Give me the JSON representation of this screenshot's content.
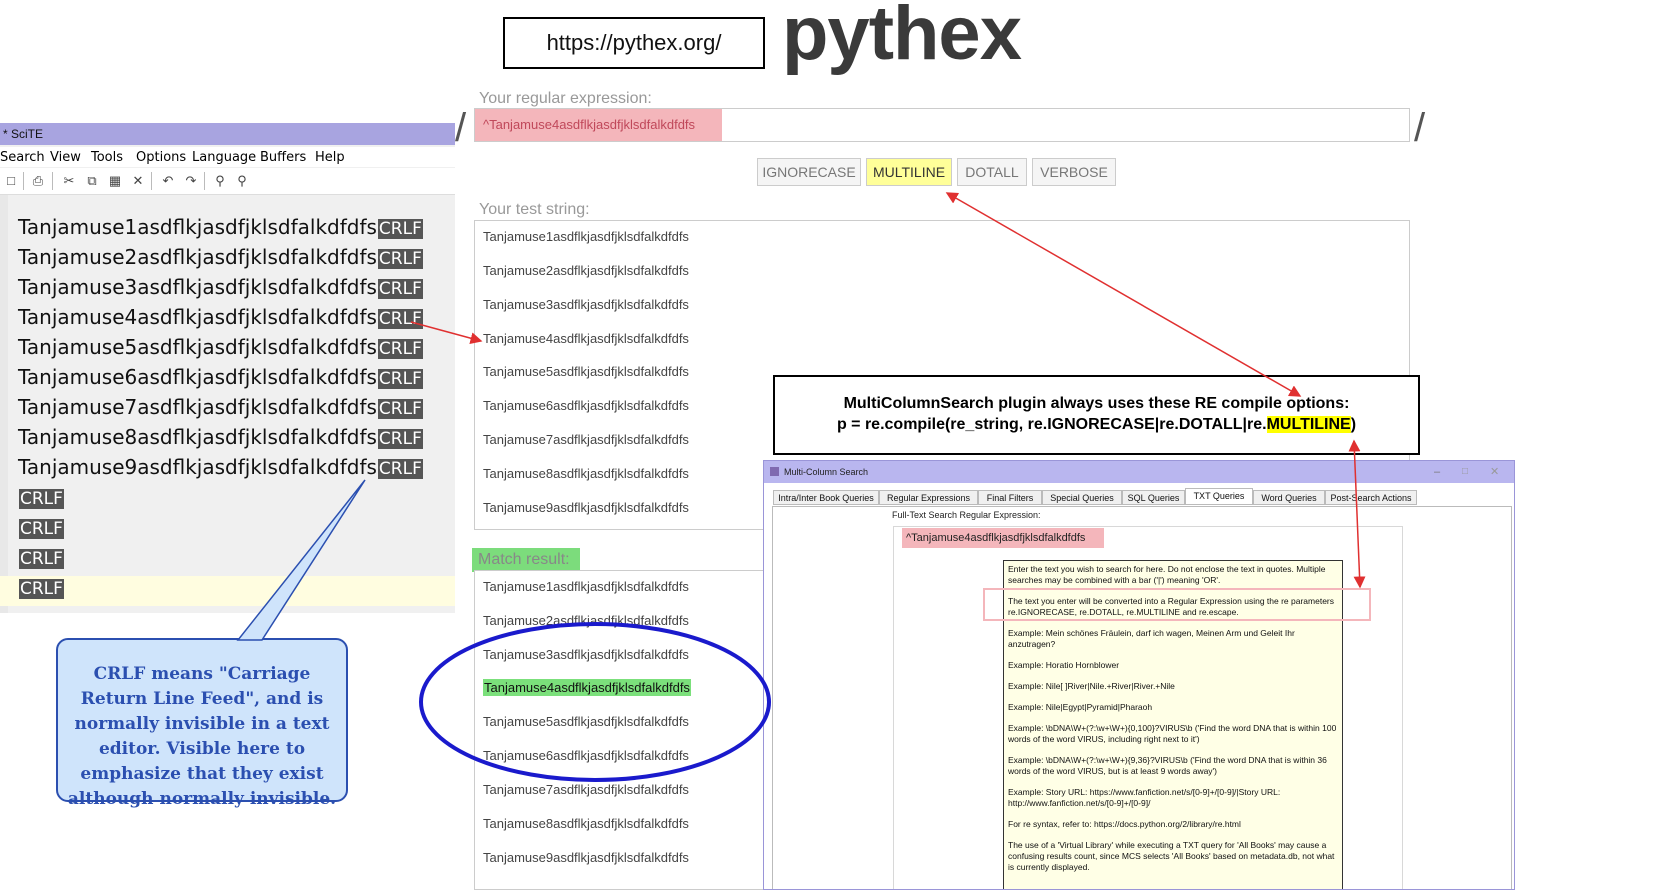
{
  "url_label": "https://pythex.org/",
  "logo": "pythex",
  "scite": {
    "title": "* SciTE",
    "menu": [
      "Search",
      "View",
      "Tools",
      "Options",
      "Language",
      "Buffers",
      "Help"
    ],
    "lines": [
      "Tanjamuse1asdflkjasdfjklsdfalkdfdfs",
      "Tanjamuse2asdflkjasdfjklsdfalkdfdfs",
      "Tanjamuse3asdflkjasdfjklsdfalkdfdfs",
      "Tanjamuse4asdflkjasdfjklsdfalkdfdfs",
      "Tanjamuse5asdflkjasdfjklsdfalkdfdfs",
      "Tanjamuse6asdflkjasdfjklsdfalkdfdfs",
      "Tanjamuse7asdflkjasdfjklsdfalkdfdfs",
      "Tanjamuse8asdflkjasdfjklsdfalkdfdfs",
      "Tanjamuse9asdflkjasdfjklsdfalkdfdfs",
      "",
      "",
      "",
      ""
    ],
    "eol_marker": "CRLF"
  },
  "callout": {
    "text": "CRLF means \"Carriage Return Line Feed\", and is normally invisible in a text editor.  Visible here to emphasize that they exist although normally invisible."
  },
  "pythex": {
    "regex_label": "Your regular expression:",
    "regex_value": "^Tanjamuse4asdflkjasdfjklsdfalkdfdfs",
    "slash": "/",
    "flags": [
      "IGNORECASE",
      "MULTILINE",
      "DOTALL",
      "VERBOSE"
    ],
    "active_flag": "MULTILINE",
    "test_label": "Your test string:",
    "test_lines": [
      "Tanjamuse1asdflkjasdfjklsdfalkdfdfs",
      "Tanjamuse2asdflkjasdfjklsdfalkdfdfs",
      "Tanjamuse3asdflkjasdfjklsdfalkdfdfs",
      "Tanjamuse4asdflkjasdfjklsdfalkdfdfs",
      "Tanjamuse5asdflkjasdfjklsdfalkdfdfs",
      "Tanjamuse6asdflkjasdfjklsdfalkdfdfs",
      "Tanjamuse7asdflkjasdfjklsdfalkdfdfs",
      "Tanjamuse8asdflkjasdfjklsdfalkdfdfs",
      "Tanjamuse9asdflkjasdfjklsdfalkdfdfs"
    ],
    "match_label": "Match result:",
    "match_lines": [
      "Tanjamuse1asdflkjasdfjklsdfalkdfdfs",
      "Tanjamuse2asdflkjasdfjklsdfalkdfdfs",
      "Tanjamuse3asdflkjasdfjklsdfalkdfdfs",
      "Tanjamuse4asdflkjasdfjklsdfalkdfdfs",
      "Tanjamuse5asdflkjasdfjklsdfalkdfdfs",
      "Tanjamuse6asdflkjasdfjklsdfalkdfdfs",
      "Tanjamuse7asdflkjasdfjklsdfalkdfdfs",
      "Tanjamuse8asdflkjasdfjklsdfalkdfdfs",
      "Tanjamuse9asdflkjasdfjklsdfalkdfdfs"
    ],
    "matched_line": "Tanjamuse4asdflkjasdfjklsdfalkdfdfs"
  },
  "note": {
    "line1": "MultiColumnSearch plugin always uses these RE compile options:",
    "line2_prefix": "p = re.compile(re_string, re.IGNORECASE|re.DOTALL|re.",
    "line2_highlight": "MULTILINE",
    "line2_suffix": ")"
  },
  "mcs": {
    "title": "Multi-Column Search",
    "tabs": [
      "Intra/Inter Book Queries",
      "Regular Expressions",
      "Final Filters",
      "Special Queries",
      "SQL Queries",
      "TXT Queries",
      "Word Queries",
      "Post-Search Actions"
    ],
    "active_tab": "TXT Queries",
    "field_label": "Full-Text Search Regular Expression:",
    "regex_value": "^Tanjamuse4asdflkjasdfjklsdfalkdfdfs",
    "tooltip": [
      "Enter the text you wish to search for here. Do not enclose the text in quotes. Multiple searches may be combined with a bar ('|') meaning 'OR'.",
      "The text you enter will be converted into a Regular Expression using the re parameters re.IGNORECASE, re.DOTALL, re.MULTILINE and re.escape.",
      "Example: Mein schönes Fräulein, darf ich wagen, Meinen Arm und Geleit Ihr anzutragen?",
      "Example: Horatio Hornblower",
      "Example: Nile[ ]River|Nile.+River|River.+Nile",
      "Example: Nile|Egypt|Pyramid|Pharaoh",
      "Example: \\bDNA\\W+(?:\\w+\\W+){0,100}?VIRUS\\b ('Find the word DNA that is within 100 words of the word VIRUS, including right next to it')",
      "Example: \\bDNA\\W+(?:\\w+\\W+){9,36}?VIRUS\\b ('Find the word DNA that is within 36 words of the word VIRUS, but is at least 9 words away')",
      "Example: Story URL: https://www.fanfiction.net/s/[0-9]+/[0-9]/|Story URL: http://www.fanfiction.net/s/[0-9]+/[0-9]/",
      "For re syntax, refer to: https://docs.python.org/2/library/re.html",
      "The use of a 'Virtual Library' while executing a TXT query for 'All Books' may cause a confusing results count, since MCS selects 'All Books' based on metadata.db, not what is currently displayed."
    ]
  },
  "colors": {
    "regex_bg": "#f4b6bb",
    "match_bg": "#7be07b",
    "annotation_arrow": "#e03030",
    "callout_fill": "#cfe4fb",
    "callout_border": "#2b4fb0",
    "ellipse": "#1a1acc",
    "highlight": "#ffff00"
  }
}
